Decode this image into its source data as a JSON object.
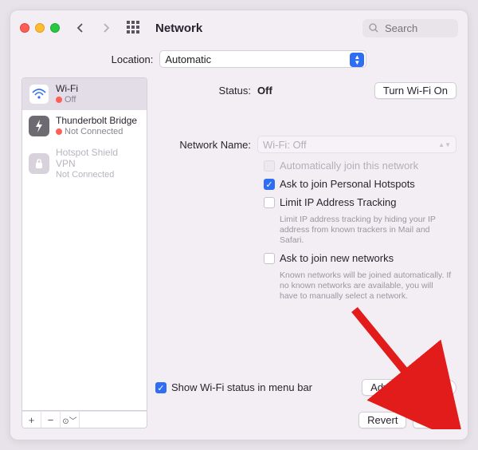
{
  "window": {
    "title": "Network"
  },
  "search": {
    "placeholder": "Search"
  },
  "location": {
    "label": "Location:",
    "value": "Automatic"
  },
  "sidebar": {
    "items": [
      {
        "name": "Wi-Fi",
        "status": "Off"
      },
      {
        "name": "Thunderbolt Bridge",
        "status": "Not Connected"
      },
      {
        "name": "Hotspot Shield VPN",
        "status": "Not Connected"
      }
    ]
  },
  "detail": {
    "status_label": "Status:",
    "status_value": "Off",
    "toggle_label": "Turn Wi-Fi On",
    "network_name_label": "Network Name:",
    "network_name_value": "Wi-Fi: Off",
    "opts": {
      "auto_join": "Automatically join this network",
      "personal_hotspots": "Ask to join Personal Hotspots",
      "limit_ip": "Limit IP Address Tracking",
      "limit_ip_help": "Limit IP address tracking by hiding your IP address from known trackers in Mail and Safari.",
      "ask_new": "Ask to join new networks",
      "ask_new_help": "Known networks will be joined automatically. If no known networks are available, you will have to manually select a network."
    },
    "show_menu": "Show Wi-Fi status in menu bar",
    "advanced": "Advanced…",
    "help": "?",
    "revert": "Revert",
    "apply": "Apply"
  }
}
